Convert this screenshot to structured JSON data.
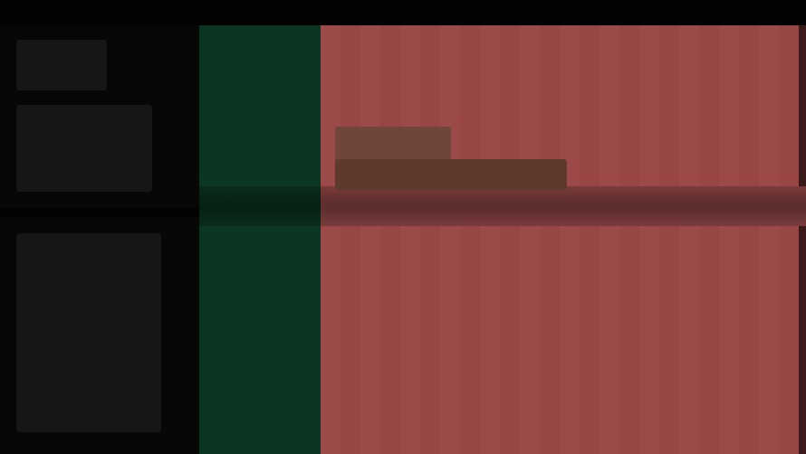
{
  "window": {
    "title": ""
  },
  "colors": {
    "background": "#050505",
    "sidebar": "#070707",
    "track_header_lane": "#0b3623",
    "clip_region": "#9a4646",
    "clip_overlay": "#5e3a2e",
    "divider": "#5e2f2f"
  },
  "icons": {
    "track_handle": "grip-icon"
  },
  "sidebar": {
    "panels": [
      {
        "label": ""
      },
      {
        "label": ""
      },
      {
        "label": ""
      }
    ]
  }
}
